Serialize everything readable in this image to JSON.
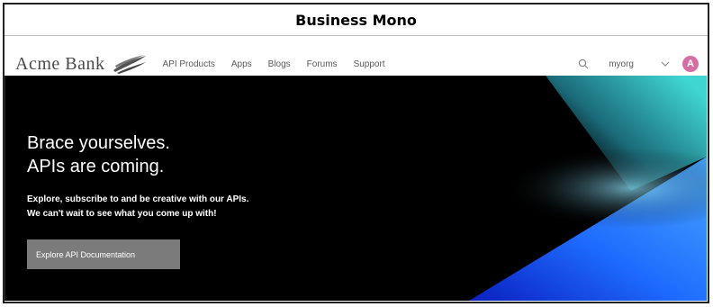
{
  "caption": "Business Mono",
  "navbar": {
    "brand": "Acme Bank",
    "links": [
      "API Products",
      "Apps",
      "Blogs",
      "Forums",
      "Support"
    ],
    "org": "myorg",
    "avatar_initial": "A",
    "icons": {
      "logo": "wave-logo-icon",
      "search": "search-icon",
      "dropdown": "chevron-down-icon"
    }
  },
  "hero": {
    "title_line1": "Brace yourselves.",
    "title_line2": "APIs are coming.",
    "subtitle_line1": "Explore, subscribe to and be creative with our APIs.",
    "subtitle_line2": "We can't wait to see what you come up with!",
    "cta_label": "Explore API Documentation"
  },
  "colors": {
    "hero_background": "#000000",
    "accent_blue": "#1e6bff",
    "accent_teal": "#3fd6d2",
    "avatar": "#d56fa3",
    "cta_background": "#7b7b7b"
  }
}
